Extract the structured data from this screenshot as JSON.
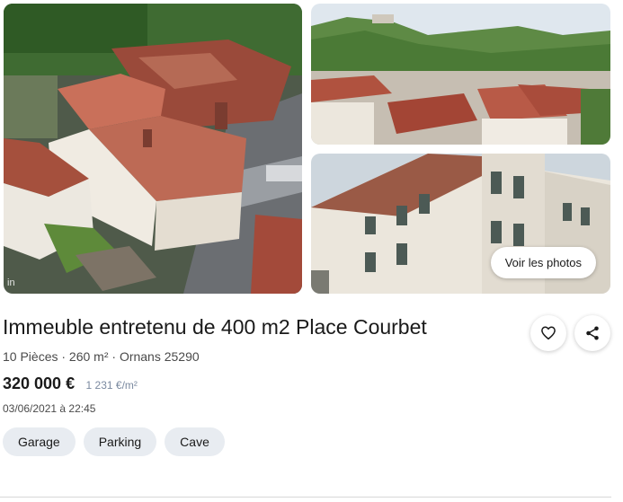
{
  "gallery": {
    "corner_text": "in",
    "see_photos_label": "Voir les photos"
  },
  "listing": {
    "title": "Immeuble entretenu de 400 m2 Place Courbet",
    "subtitle": "10 Pièces · 260 m² · Ornans 25290",
    "price": "320 000 €",
    "price_per_m2": "1 231 €/m²",
    "date": "03/06/2021 à 22:45",
    "tags": [
      "Garage",
      "Parking",
      "Cave"
    ]
  },
  "actions": {
    "favorite_icon": "heart-icon",
    "share_icon": "share-icon"
  },
  "colors": {
    "tag_bg": "#e8ecf1",
    "price_per_m2": "#7b8aa0",
    "roof": "#b5543f",
    "wall": "#ebe6dc"
  }
}
